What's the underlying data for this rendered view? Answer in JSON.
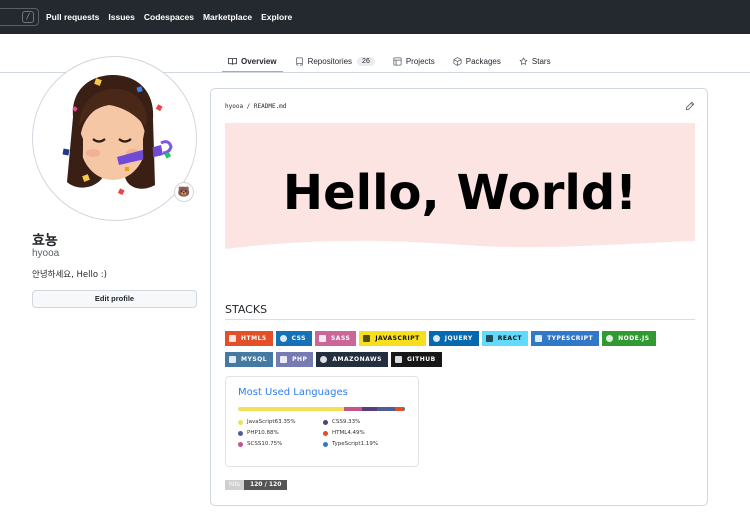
{
  "header": {
    "search_hint": "/",
    "nav": [
      "Pull requests",
      "Issues",
      "Codespaces",
      "Marketplace",
      "Explore"
    ]
  },
  "tabs": [
    {
      "label": "Overview",
      "icon": "book-icon",
      "active": true
    },
    {
      "label": "Repositories",
      "icon": "repo-icon",
      "count": "26"
    },
    {
      "label": "Projects",
      "icon": "project-icon"
    },
    {
      "label": "Packages",
      "icon": "package-icon"
    },
    {
      "label": "Stars",
      "icon": "star-icon"
    }
  ],
  "profile": {
    "name": "효뇽",
    "login": "hyooa",
    "bio": "안녕하세요, Hello :)",
    "edit_label": "Edit profile",
    "status_emoji": "🐻"
  },
  "readme": {
    "path": "hyooa / README.md",
    "banner_text": "Hello, World!",
    "banner_color": "#fbe4e2",
    "stacks_title": "STACKS",
    "badges": [
      {
        "label": "HTML5",
        "color": "#e34f26"
      },
      {
        "label": "CSS",
        "color": "#1572b6"
      },
      {
        "label": "SASS",
        "color": "#cc6699"
      },
      {
        "label": "JAVASCRIPT",
        "color": "#f7df1e",
        "dark": true
      },
      {
        "label": "JQUERY",
        "color": "#0769ad"
      },
      {
        "label": "REACT",
        "color": "#61dafb",
        "dark": true
      },
      {
        "label": "TYPESCRIPT",
        "color": "#3178c6"
      },
      {
        "label": "NODE.JS",
        "color": "#339933"
      },
      {
        "label": "MYSQL",
        "color": "#4479a1"
      },
      {
        "label": "PHP",
        "color": "#777bb4"
      },
      {
        "label": "AMAZONAWS",
        "color": "#232f3e"
      },
      {
        "label": "GITHUB",
        "color": "#181717"
      }
    ],
    "languages": {
      "title": "Most Used Languages",
      "items": [
        {
          "name": "JavaScript",
          "pct": "63.35%",
          "value": 63.35,
          "color": "#f1e05a"
        },
        {
          "name": "CSS",
          "pct": "9.33%",
          "value": 9.33,
          "color": "#563d7c"
        },
        {
          "name": "PHP",
          "pct": "10.88%",
          "value": 10.88,
          "color": "#4f5d95"
        },
        {
          "name": "HTML",
          "pct": "4.49%",
          "value": 4.49,
          "color": "#e34c26"
        },
        {
          "name": "SCSS",
          "pct": "10.75%",
          "value": 10.75,
          "color": "#c6538c"
        },
        {
          "name": "TypeScript",
          "pct": "1.19%",
          "value": 1.19,
          "color": "#3178c6"
        }
      ]
    },
    "hits": {
      "label": "hits",
      "value": "120 / 120"
    }
  }
}
